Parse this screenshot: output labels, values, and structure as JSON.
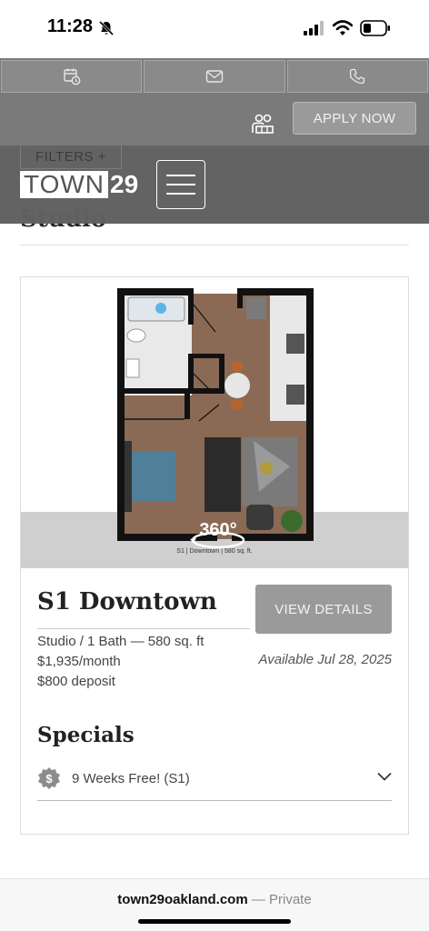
{
  "status_bar": {
    "time": "11:28"
  },
  "contact_bar": {
    "icons": [
      "calendar-clock-icon",
      "mail-icon",
      "phone-icon"
    ]
  },
  "header": {
    "apply_label": "APPLY NOW",
    "filters_label": "FILTERS +",
    "logo_text": "TOWN",
    "logo_number": "29"
  },
  "section": {
    "heading": "Studio"
  },
  "card": {
    "floorplan_caption": "S1   |   Downtown   |   580 sq. ft.",
    "tour_label": "360°",
    "title": "S1 Downtown",
    "view_label": "VIEW DETAILS",
    "layout": "Studio /  1  Bath   — 580 sq. ft",
    "price": "$1,935/month",
    "deposit": "$800 deposit",
    "available": "Available Jul 28, 2025",
    "specials_title": "Specials",
    "special_label": "9 Weeks Free! (S1)"
  },
  "browser": {
    "domain": "town29oakland.com",
    "private_label": " — Private"
  },
  "colors": {
    "header_gray": "#7a7a7a",
    "logo_bar": "#636363",
    "button_gray": "#9a9a9a",
    "floor_wood": "#8a6a55"
  }
}
